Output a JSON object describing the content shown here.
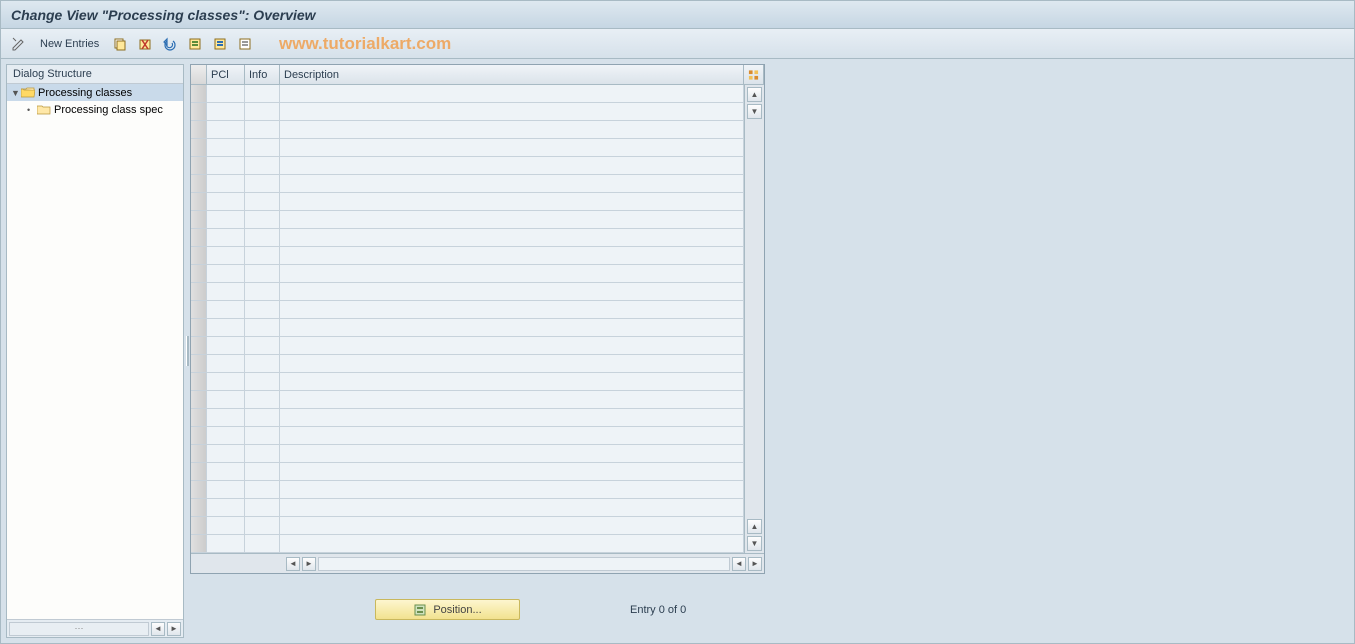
{
  "title": "Change View \"Processing classes\": Overview",
  "toolbar": {
    "new_entries_label": "New Entries"
  },
  "watermark": "www.tutorialkart.com",
  "sidebar": {
    "header": "Dialog Structure",
    "items": [
      {
        "label": "Processing classes",
        "selected": true,
        "level": 0,
        "open": true
      },
      {
        "label": "Processing class spec",
        "selected": false,
        "level": 1,
        "open": false
      }
    ]
  },
  "grid": {
    "columns": {
      "pcl": "PCl",
      "info": "Info",
      "desc": "Description"
    },
    "row_count": 26
  },
  "footer": {
    "position_label": "Position...",
    "entry_text": "Entry 0 of 0"
  }
}
